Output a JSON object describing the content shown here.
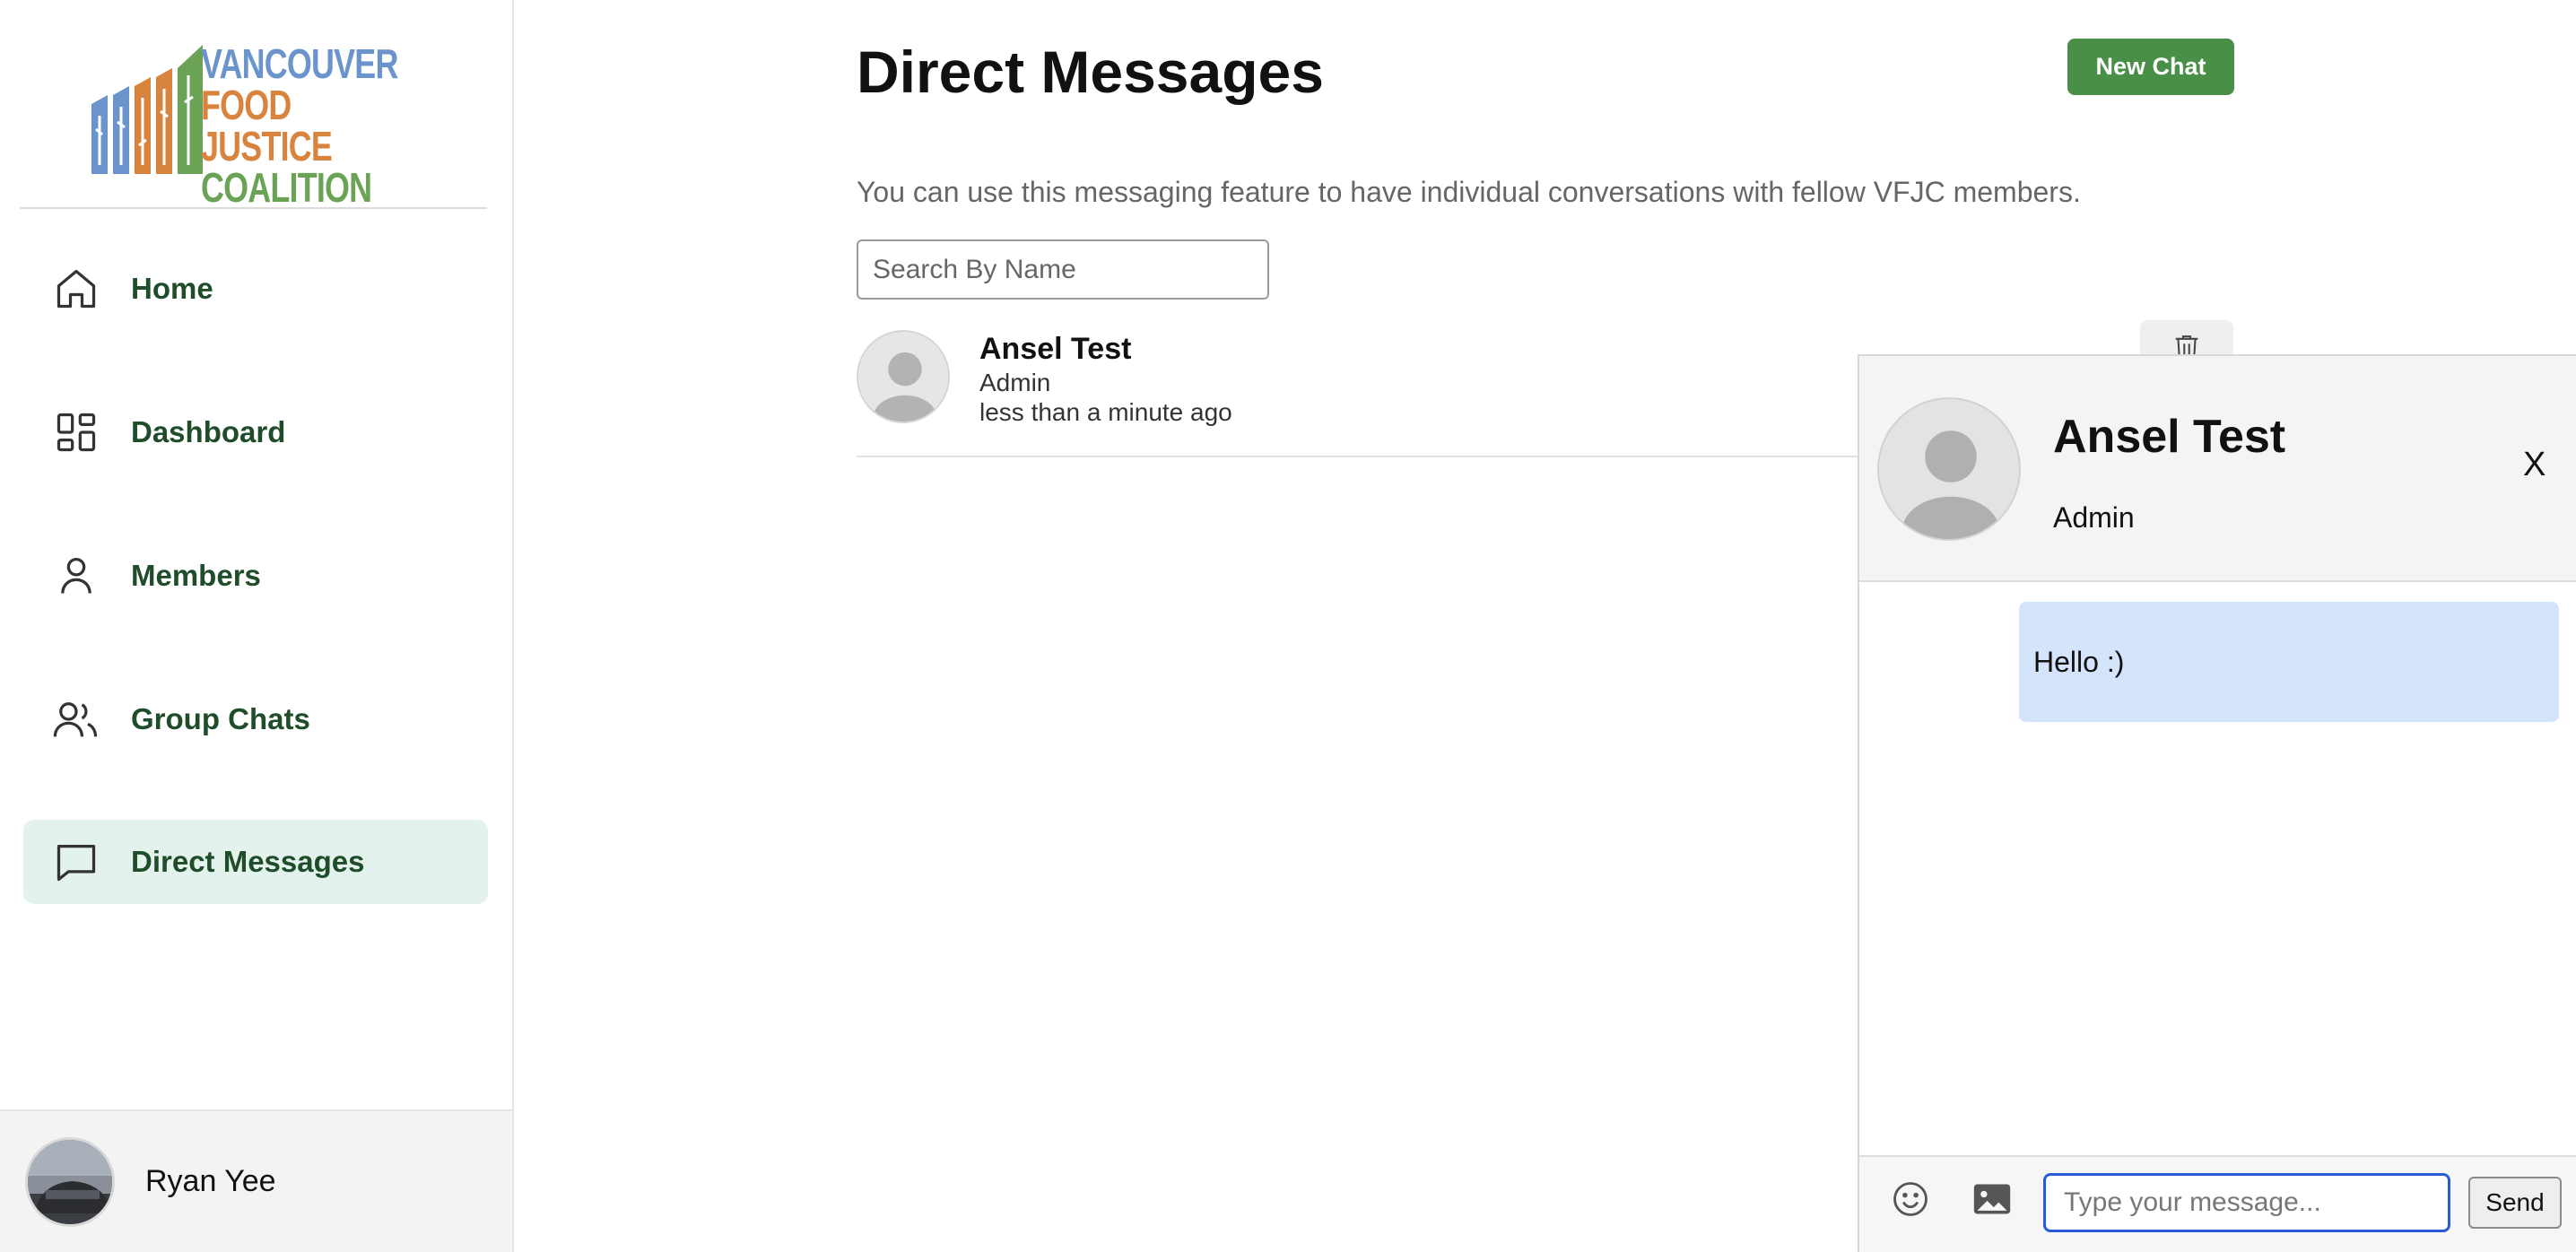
{
  "sidebar": {
    "logo": {
      "lines": [
        "VANCOUVER",
        "FOOD JUSTICE",
        "COALITION"
      ]
    },
    "items": [
      {
        "label": "Home",
        "icon": "home-icon"
      },
      {
        "label": "Dashboard",
        "icon": "dashboard-icon"
      },
      {
        "label": "Members",
        "icon": "person-icon"
      },
      {
        "label": "Group Chats",
        "icon": "people-icon"
      },
      {
        "label": "Direct Messages",
        "icon": "message-icon",
        "active": true
      }
    ],
    "user": {
      "name": "Ryan Yee"
    }
  },
  "main": {
    "title": "Direct Messages",
    "new_chat_label": "New Chat",
    "description": "You can use this messaging feature to have individual conversations with fellow VFJC members.",
    "search_placeholder": "Search By Name",
    "conversations": [
      {
        "name": "Ansel Test",
        "role": "Admin",
        "time": "less than a minute ago"
      }
    ]
  },
  "chat": {
    "name": "Ansel Test",
    "role": "Admin",
    "close_label": "X",
    "messages": [
      {
        "text": "Hello :)",
        "from": "me"
      }
    ],
    "input_placeholder": "Type your message...",
    "send_label": "Send"
  },
  "colors": {
    "brand_green": "#4a8f48",
    "nav_text": "#1f4d2a",
    "active_bg": "#e4f2ee",
    "bubble": "#d4e4fa"
  }
}
